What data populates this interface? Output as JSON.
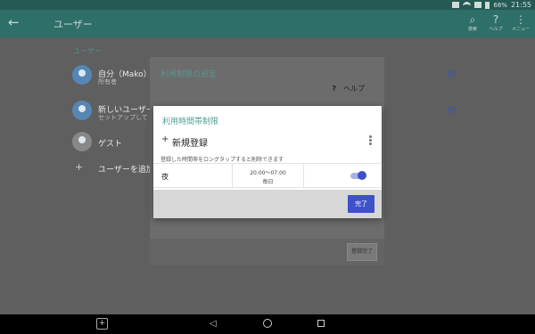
{
  "status_bar": {
    "time": "21:55",
    "battery": "66%"
  },
  "app_bar": {
    "back_icon": "arrow-left-icon",
    "title": "ユーザー",
    "actions": [
      {
        "icon": "search-icon",
        "label": "検索"
      },
      {
        "icon": "help-icon",
        "label": "ヘルプ"
      },
      {
        "icon": "more-vert-icon",
        "label": "メニュー"
      }
    ]
  },
  "users_section": {
    "header": "ユーザー",
    "rows": [
      {
        "name": "自分（Mako）",
        "sub": "所有者"
      },
      {
        "name": "新しいユーザー",
        "sub": "セットアップして"
      },
      {
        "name": "ゲスト"
      }
    ],
    "add_label": "ユーザーを追加"
  },
  "limit_dialog": {
    "title": "利用制限の設定",
    "help_mark": "?",
    "help_label": "ヘルプ",
    "done_label": "登録完了"
  },
  "time_dialog": {
    "title": "利用時間帯制限",
    "new_label": "新規登録",
    "hint": "登録した時間帯をロングタップすると削除できます",
    "entries": [
      {
        "name": "夜",
        "time": "20:00〜07:00",
        "days": "毎日",
        "enabled": true
      }
    ],
    "done_label": "完了"
  },
  "colors": {
    "accent": "#3f51c8",
    "teal": "#2f6f69"
  }
}
